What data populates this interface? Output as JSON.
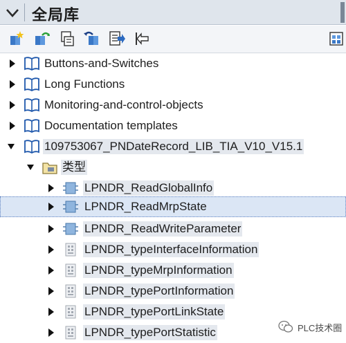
{
  "panel": {
    "title": "全局库"
  },
  "toolbar": {
    "buttons": [
      {
        "icon": "new-library-icon"
      },
      {
        "icon": "open-library-icon"
      },
      {
        "icon": "save-library-icon"
      },
      {
        "icon": "update-types-icon"
      },
      {
        "icon": "library-report-icon"
      },
      {
        "icon": "export-icon"
      },
      {
        "icon": "library-view-icon"
      }
    ]
  },
  "tree": {
    "libraries": [
      {
        "label": "Buttons-and-Switches",
        "expanded": false
      },
      {
        "label": "Long Functions",
        "expanded": false
      },
      {
        "label": "Monitoring-and-control-objects",
        "expanded": false
      },
      {
        "label": "Documentation templates",
        "expanded": false
      },
      {
        "label": "109753067_PNDateRecord_LIB_TIA_V10_V15.1",
        "expanded": true
      }
    ],
    "types_folder": {
      "label": "类型",
      "expanded": true
    },
    "types": [
      {
        "label": "LPNDR_ReadGlobalInfo",
        "kind": "function-block"
      },
      {
        "label": "LPNDR_ReadMrpState",
        "kind": "function-block",
        "selected": true
      },
      {
        "label": "LPNDR_ReadWriteParameter",
        "kind": "function-block"
      },
      {
        "label": "LPNDR_typeInterfaceInformation",
        "kind": "data-type"
      },
      {
        "label": "LPNDR_typeMrpInformation",
        "kind": "data-type"
      },
      {
        "label": "LPNDR_typePortInformation",
        "kind": "data-type"
      },
      {
        "label": "LPNDR_typePortLinkState",
        "kind": "data-type"
      },
      {
        "label": "LPNDR_typePortStatistic",
        "kind": "data-type"
      }
    ]
  },
  "watermark": {
    "text": "PLC技术圈"
  }
}
